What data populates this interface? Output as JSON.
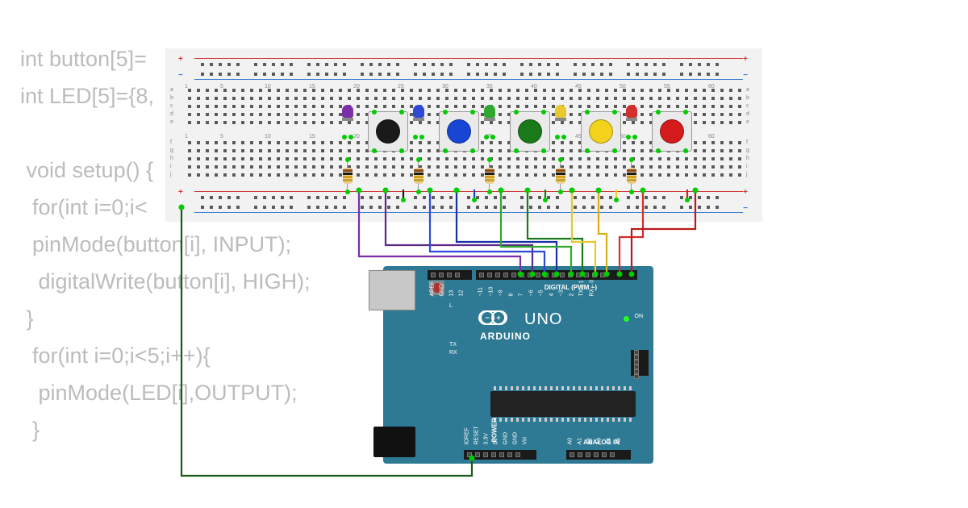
{
  "code": {
    "line1": "int button[5]=",
    "line2": "int LED[5]={8,",
    "line3": "",
    "line4": " void setup() {",
    "line5": "  for(int i=0;i<",
    "line6": "  pinMode(button[i], INPUT);",
    "line7": "   digitalWrite(button[i], HIGH);",
    "line8": " }",
    "line9": "  for(int i=0;i<5;i++){",
    "line10": "   pinMode(LED[i],OUTPUT);",
    "line11": "  }"
  },
  "breadboard": {
    "column_numbers": [
      1,
      5,
      10,
      15,
      20,
      25,
      30,
      35,
      40,
      45,
      50,
      55,
      60
    ],
    "row_letters_top": [
      "a",
      "b",
      "c",
      "d",
      "e"
    ],
    "row_letters_bot": [
      "f",
      "g",
      "h",
      "i",
      "j"
    ],
    "rail_plus": "+",
    "rail_minus": "−"
  },
  "components": {
    "buttons": [
      {
        "id": "btn-black",
        "color": "#1a1a1a",
        "column": 22
      },
      {
        "id": "btn-blue",
        "color": "#1846d4",
        "column": 30
      },
      {
        "id": "btn-green",
        "color": "#1a7a1a",
        "column": 38
      },
      {
        "id": "btn-yellow",
        "color": "#f2d21a",
        "column": 46
      },
      {
        "id": "btn-red",
        "color": "#d41a1a",
        "column": 54
      }
    ],
    "leds": [
      {
        "id": "led-purple",
        "color": "#7a2ea8",
        "column": 19
      },
      {
        "id": "led-blue",
        "color": "#2e4ad4",
        "column": 27
      },
      {
        "id": "led-green",
        "color": "#2ea82e",
        "column": 35
      },
      {
        "id": "led-yellow",
        "color": "#e8c82e",
        "column": 43
      },
      {
        "id": "led-red",
        "color": "#d42e2e",
        "column": 51
      }
    ],
    "resistors": [
      {
        "column": 19,
        "bands": [
          "#8a4a1a",
          "#1a1a1a",
          "#d4a01a",
          "#c9a227"
        ]
      },
      {
        "column": 27,
        "bands": [
          "#8a4a1a",
          "#1a1a1a",
          "#d4a01a",
          "#c9a227"
        ]
      },
      {
        "column": 35,
        "bands": [
          "#8a4a1a",
          "#1a1a1a",
          "#d4a01a",
          "#c9a227"
        ]
      },
      {
        "column": 43,
        "bands": [
          "#8a4a1a",
          "#1a1a1a",
          "#d4a01a",
          "#c9a227"
        ]
      },
      {
        "column": 51,
        "bands": [
          "#8a4a1a",
          "#1a1a1a",
          "#d4a01a",
          "#c9a227"
        ]
      }
    ],
    "wires": [
      {
        "color": "#7a2ea8",
        "name": "purple-led-to-d9"
      },
      {
        "color": "#7a2ea8",
        "name": "purple-btn-to-d4"
      },
      {
        "color": "#2e4ad4",
        "name": "blue-led-to-d8"
      },
      {
        "color": "#2e4ad4",
        "name": "blue-btn-to-d3"
      },
      {
        "color": "#2ea82e",
        "name": "green-led-to-d7"
      },
      {
        "color": "#2ea82e",
        "name": "green-btn-to-d2"
      },
      {
        "color": "#e8c82e",
        "name": "yellow-led-to-d6"
      },
      {
        "color": "#e8c82e",
        "name": "yellow-btn-to-d1"
      },
      {
        "color": "#d42e2e",
        "name": "red-led-to-d5"
      },
      {
        "color": "#d42e2e",
        "name": "red-btn-to-d0"
      },
      {
        "color": "#1a5a1a",
        "name": "gnd-rail-to-arduino"
      }
    ]
  },
  "arduino": {
    "brand": "ARDUINO",
    "model": "UNO",
    "on_label": "ON",
    "digital_label": "DIGITAL (PWM ~)",
    "power_label": "POWER",
    "analog_label": "ANALOG IN",
    "indicators": [
      "L",
      "TX",
      "RX"
    ],
    "digital_pins": [
      "AREF",
      "GND",
      "13",
      "12",
      "~11",
      "~10",
      "~9",
      "8",
      "7",
      "~6",
      "~5",
      "4",
      "~3",
      "2",
      "TX→1",
      "RX←0"
    ],
    "power_pins": [
      "IOREF",
      "RESET",
      "3.3V",
      "5V",
      "GND",
      "GND",
      "Vin"
    ],
    "analog_pins": [
      "A0",
      "A1",
      "A2",
      "A3",
      "A4",
      "A5"
    ],
    "logo_minus": "−",
    "logo_plus": "+"
  }
}
